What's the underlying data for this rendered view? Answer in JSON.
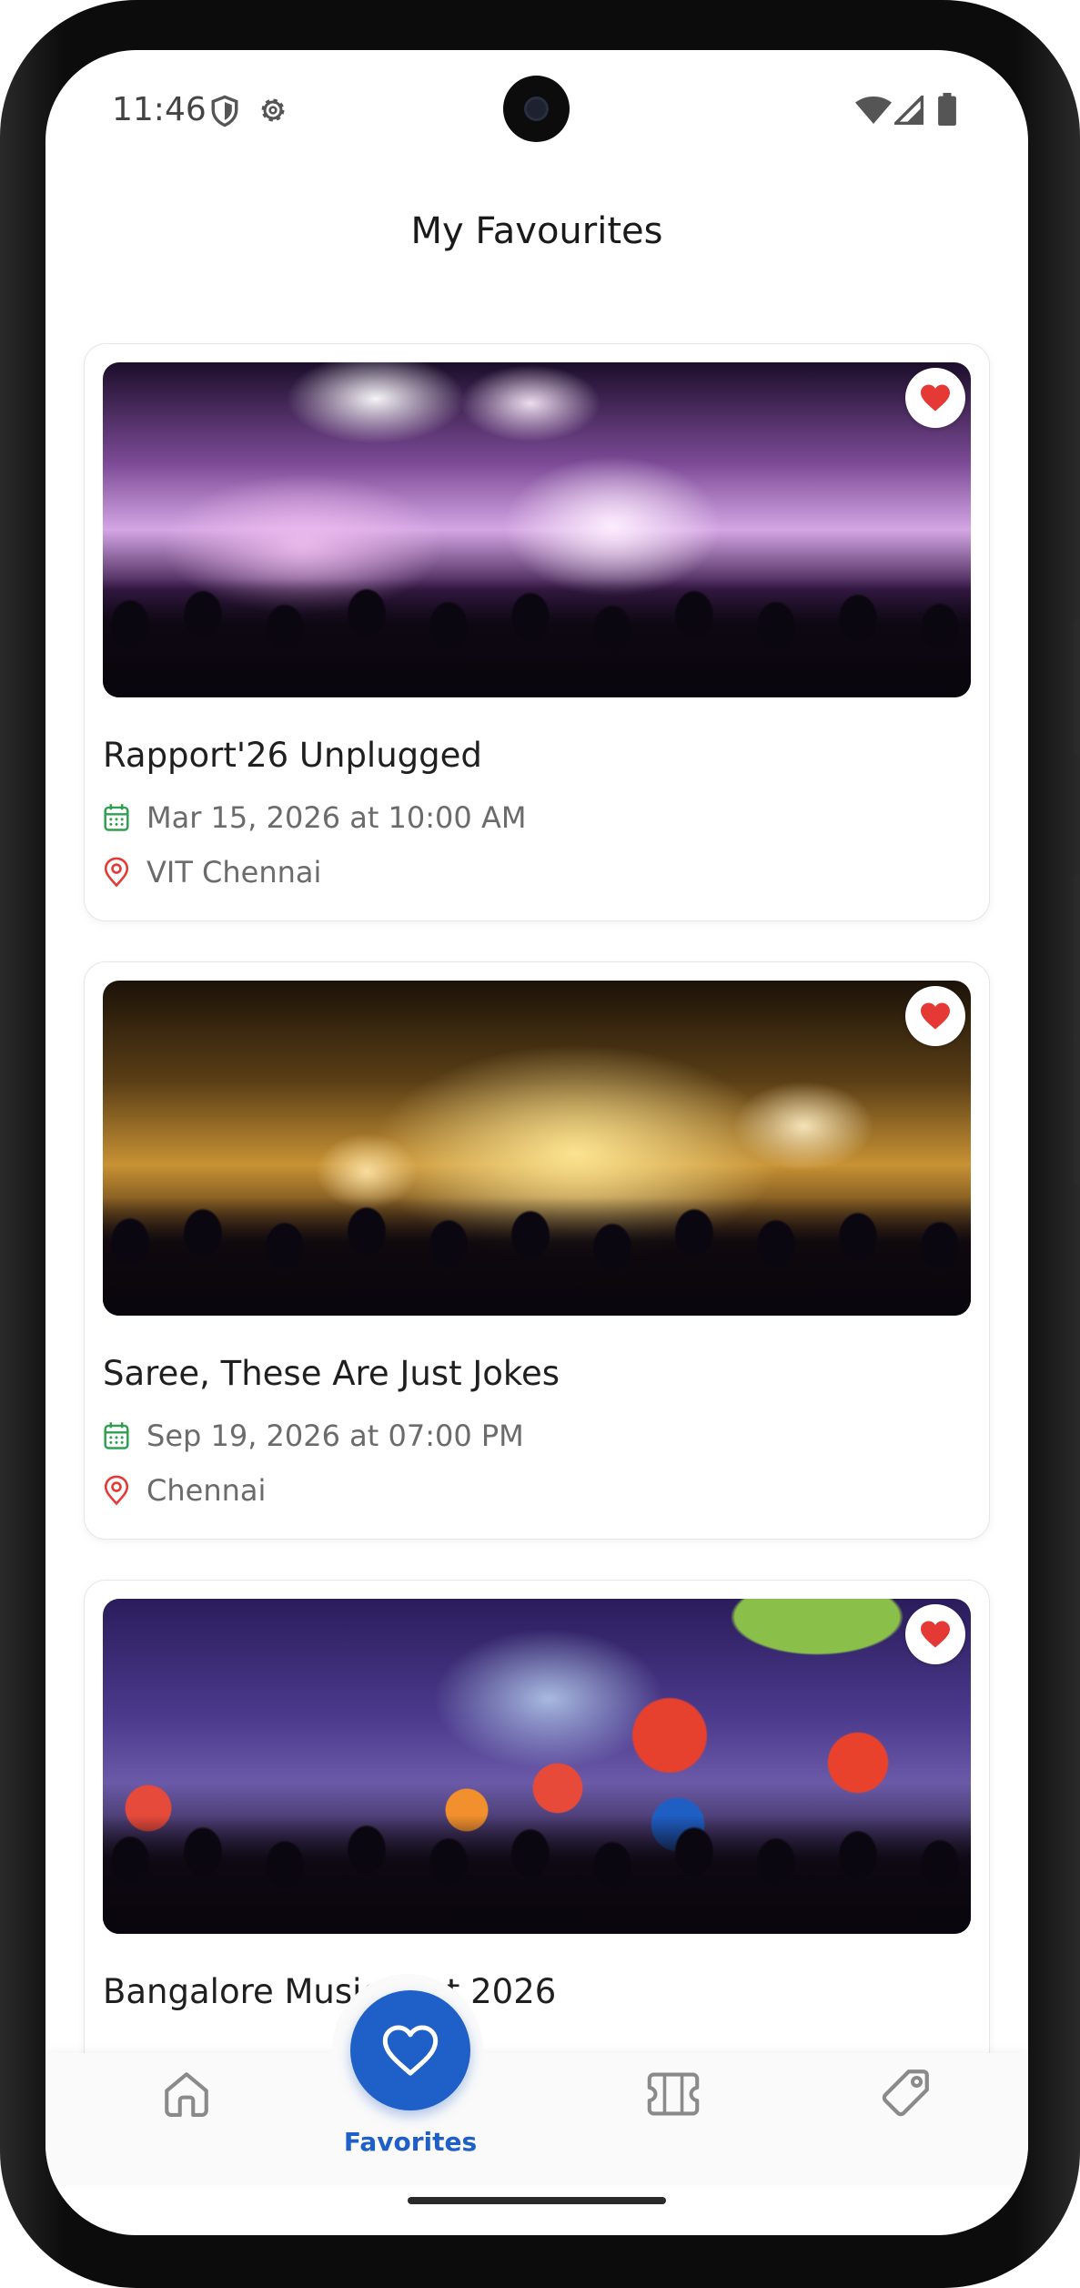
{
  "status_bar": {
    "time": "11:46",
    "icons": [
      "shield-icon",
      "gear-icon",
      "wifi-icon",
      "cell-signal-icon",
      "battery-icon"
    ]
  },
  "header": {
    "title": "My Favourites"
  },
  "events": [
    {
      "title": "Rapport'26 Unplugged",
      "datetime": "Mar 15, 2026 at 10:00 AM",
      "location": "VIT Chennai",
      "favorited": true
    },
    {
      "title": "Saree, These Are Just Jokes",
      "datetime": "Sep 19, 2026 at 07:00 PM",
      "location": "Chennai",
      "favorited": true
    },
    {
      "title": "Bangalore Music Fest 2026",
      "favorited": true
    }
  ],
  "bottom_nav": {
    "items": [
      {
        "icon": "home-icon",
        "label": ""
      },
      {
        "icon": "heart-icon",
        "label": "Favorites",
        "active": true
      },
      {
        "icon": "ticket-icon",
        "label": ""
      },
      {
        "icon": "tag-icon",
        "label": ""
      }
    ]
  },
  "colors": {
    "accent": "#1f5fc8",
    "favorite_heart": "#e53935",
    "calendar_icon": "#2e9e4f",
    "location_icon": "#e53935"
  }
}
